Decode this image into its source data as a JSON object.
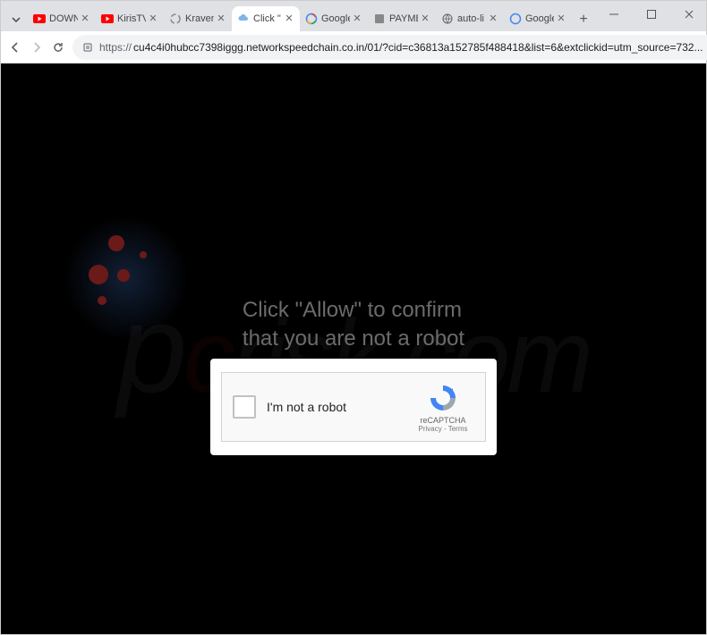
{
  "tabs": [
    {
      "title": "DOWN",
      "icon": "youtube"
    },
    {
      "title": "KirisTV",
      "icon": "youtube"
    },
    {
      "title": "Kraven",
      "icon": "spinner"
    },
    {
      "title": "Click \"",
      "icon": "cloud",
      "active": true
    },
    {
      "title": "Google",
      "icon": "google"
    },
    {
      "title": "PAYME",
      "icon": "generic"
    },
    {
      "title": "auto-li",
      "icon": "globe"
    },
    {
      "title": "Google",
      "icon": "google"
    }
  ],
  "urlbar": {
    "prefix": "https://",
    "url": "cu4c4i0hubcc7398iggg.networkspeedchain.co.in/01/?cid=c36813a152785f488418&list=6&extclickid=utm_source=732..."
  },
  "content": {
    "allow_line1": "Click \"Allow\" to confirm",
    "allow_line2": "that you are not a robot"
  },
  "captcha": {
    "label": "I'm not a robot",
    "brand": "reCAPTCHA",
    "links": "Privacy - Terms"
  },
  "watermark": "risk.com"
}
